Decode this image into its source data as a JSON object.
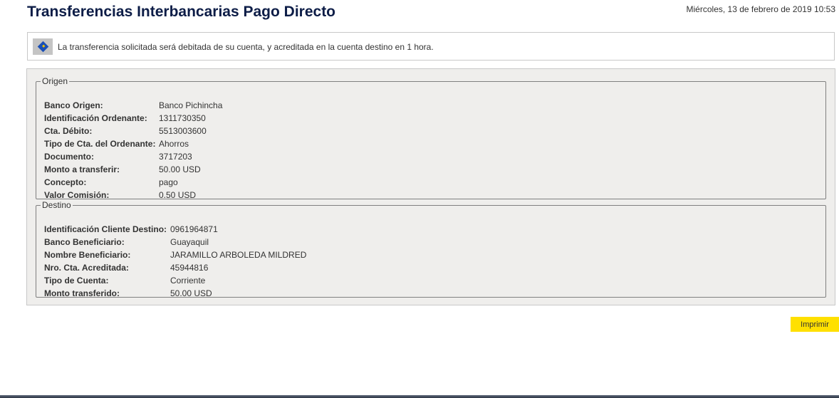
{
  "header": {
    "title": "Transferencias Interbancarias Pago Directo",
    "date": "Miércoles, 13 de febrero de 2019 10:53"
  },
  "info": {
    "icon": "info-icon",
    "message": "La transferencia solicitada será debitada de su cuenta, y acreditada en la cuenta destino en 1 hora."
  },
  "origen": {
    "legend": "Origen",
    "rows": [
      {
        "label": "Banco Origen:",
        "value": "Banco Pichincha"
      },
      {
        "label": "Identificación Ordenante:",
        "value": "1311730350"
      },
      {
        "label": "Cta. Débito:",
        "value": "5513003600"
      },
      {
        "label": "Tipo de Cta. del Ordenante:",
        "value": "Ahorros"
      },
      {
        "label": "Documento:",
        "value": "3717203"
      },
      {
        "label": "Monto a transferir:",
        "value": "50.00 USD"
      },
      {
        "label": "Concepto:",
        "value": "pago"
      },
      {
        "label": "Valor Comisión:",
        "value": "0.50 USD"
      }
    ]
  },
  "destino": {
    "legend": "Destino",
    "rows": [
      {
        "label": "Identificación Cliente Destino:",
        "value": "0961964871"
      },
      {
        "label": "Banco Beneficiario:",
        "value": "Guayaquil"
      },
      {
        "label": "Nombre Beneficiario:",
        "value": "JARAMILLO ARBOLEDA MILDRED"
      },
      {
        "label": "Nro. Cta. Acreditada:",
        "value": "45944816"
      },
      {
        "label": "Tipo de Cuenta:",
        "value": "Corriente"
      },
      {
        "label": "Monto transferido:",
        "value": "50.00 USD"
      }
    ]
  },
  "actions": {
    "print_label": "Imprimir"
  },
  "colors": {
    "title": "#0d1d47",
    "button": "#ffe000",
    "panel_bg": "#efeeec"
  }
}
